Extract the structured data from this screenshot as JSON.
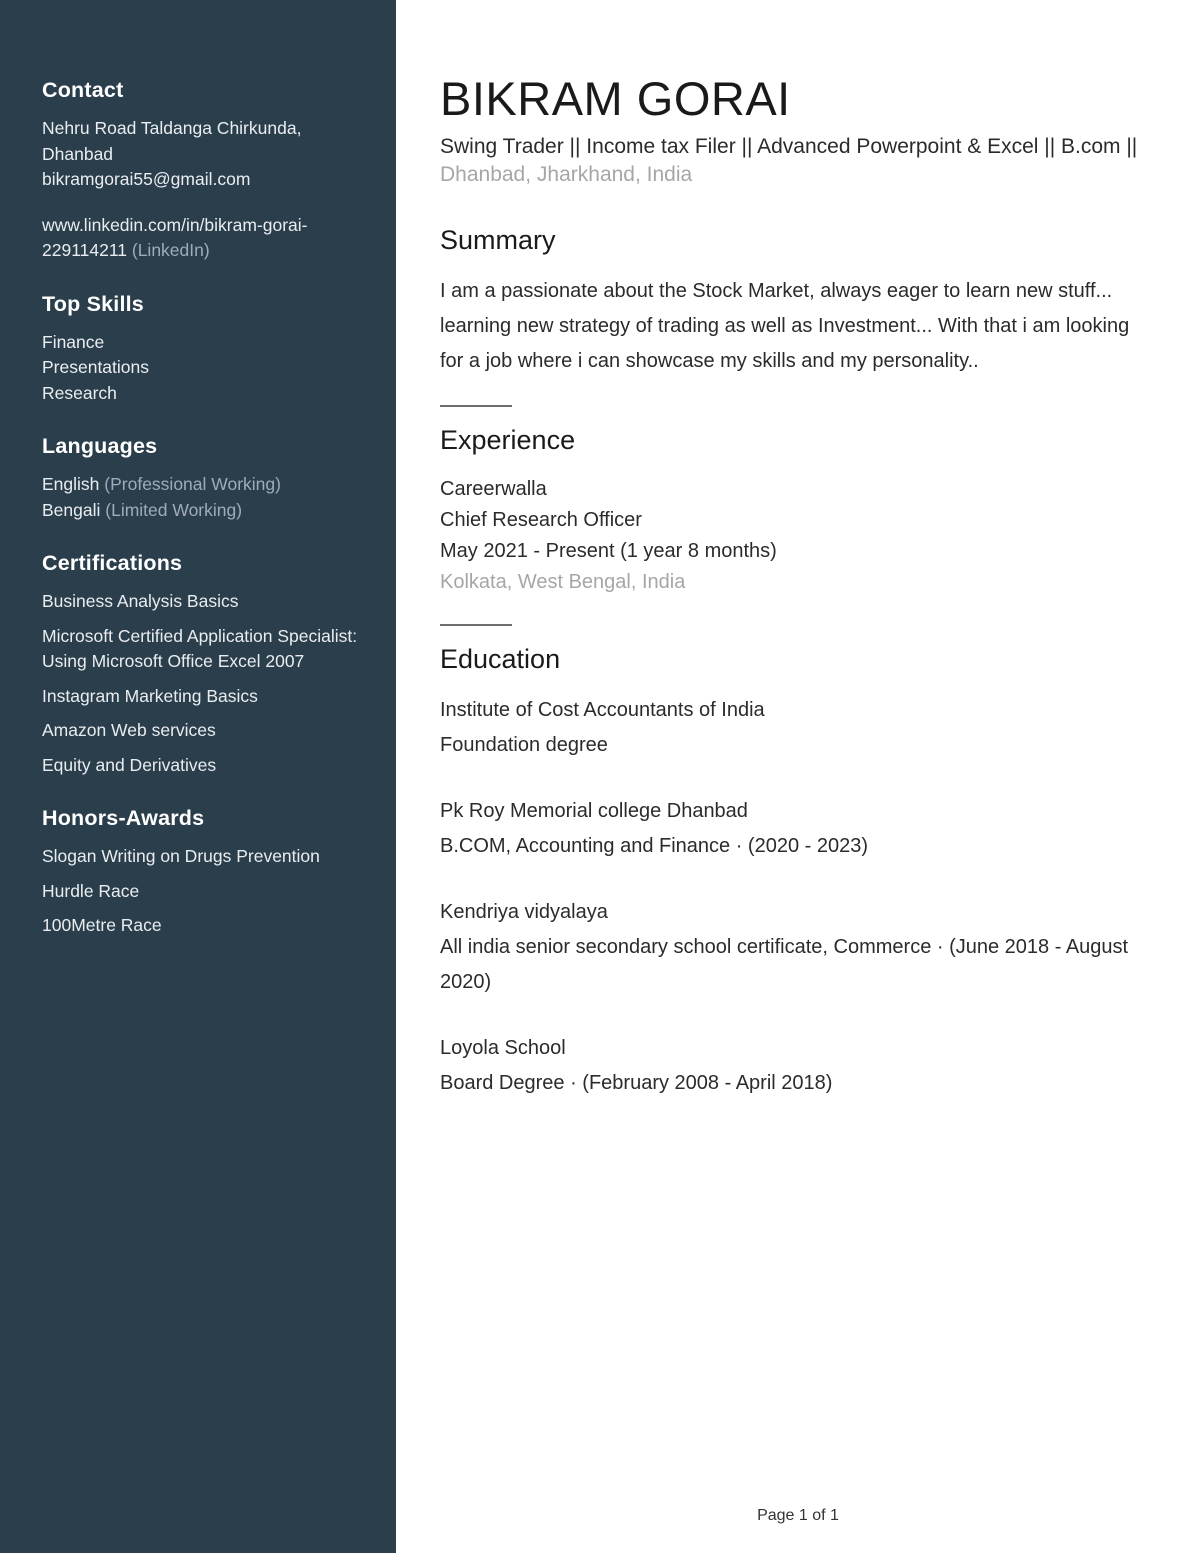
{
  "sidebar": {
    "contact": {
      "heading": "Contact",
      "address": "Nehru Road Taldanga Chirkunda, Dhanbad",
      "email": "bikramgorai55@gmail.com",
      "linkedin_url": "www.linkedin.com/in/bikram-gorai-229114211",
      "linkedin_label": "(LinkedIn)"
    },
    "top_skills": {
      "heading": "Top Skills",
      "items": [
        "Finance",
        "Presentations",
        "Research"
      ]
    },
    "languages": {
      "heading": "Languages",
      "items": [
        {
          "name": "English",
          "level": "(Professional Working)"
        },
        {
          "name": "Bengali",
          "level": "(Limited Working)"
        }
      ]
    },
    "certifications": {
      "heading": "Certifications",
      "items": [
        "Business Analysis Basics",
        "Microsoft Certified Application Specialist: Using Microsoft Office Excel 2007",
        "Instagram Marketing Basics",
        "Amazon Web services",
        "Equity and Derivatives"
      ]
    },
    "honors": {
      "heading": "Honors-Awards",
      "items": [
        "Slogan Writing on Drugs Prevention",
        "Hurdle Race",
        "100Metre Race"
      ]
    }
  },
  "main": {
    "name": "BIKRAM GORAI",
    "headline": "Swing Trader || Income tax Filer || Advanced Powerpoint & Excel || B.com ||",
    "location": "Dhanbad, Jharkhand, India",
    "summary": {
      "heading": "Summary",
      "text": "I am a passionate about the Stock Market, always eager to learn new stuff... learning new strategy of trading as well as Investment... With that i am looking for a job where i can showcase my skills and my personality.."
    },
    "experience": {
      "heading": "Experience",
      "entries": [
        {
          "company": "Careerwalla",
          "title": "Chief Research Officer",
          "dates": "May 2021 - Present (1 year 8 months)",
          "location": "Kolkata, West Bengal, India"
        }
      ]
    },
    "education": {
      "heading": "Education",
      "entries": [
        {
          "school": "Institute of Cost Accountants of India",
          "detail": "Foundation degree"
        },
        {
          "school": "Pk Roy Memorial college Dhanbad",
          "detail": "B.COM, Accounting and Finance · (2020 - 2023)"
        },
        {
          "school": "Kendriya vidyalaya",
          "detail": "All india senior secondary school certificate, Commerce · (June 2018 - August 2020)"
        },
        {
          "school": "Loyola School",
          "detail": "Board Degree  · (February 2008 - April 2018)"
        }
      ]
    }
  },
  "footer": {
    "page_label": "Page 1 of 1"
  },
  "colors": {
    "sidebar_bg": "#2b3e4c",
    "sidebar_text": "#e9edf0",
    "sidebar_muted": "#9facb6",
    "body_text": "#2b2b2b",
    "muted_text": "#a6a6a6",
    "rule": "#6e6e6e"
  }
}
